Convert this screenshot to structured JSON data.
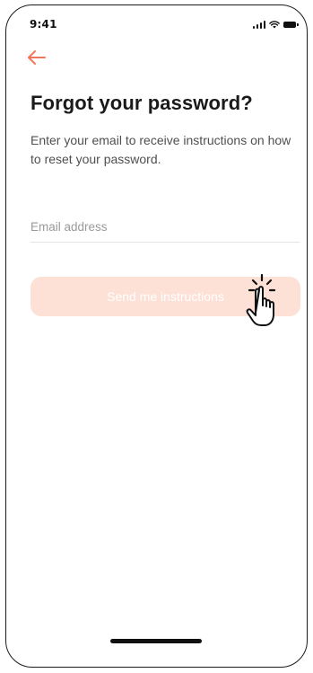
{
  "status_bar": {
    "time": "9:41",
    "icons": [
      "signal-icon",
      "wifi-icon",
      "battery-icon"
    ]
  },
  "nav": {
    "back_icon": "arrow-left-icon"
  },
  "header": {
    "title": "Forgot your password?",
    "subtitle": "Enter your email to receive instructions on how to reset your password."
  },
  "form": {
    "email_value": "",
    "email_placeholder": "Email address",
    "submit_label": "Send me instructions",
    "submit_state": "disabled"
  },
  "overlay": {
    "gesture_icon": "tap-hand-icon"
  },
  "colors": {
    "accent": "#f0775a",
    "button_disabled_bg": "#fde1d6",
    "button_text": "#ffffff",
    "title_text": "#1a1a1a",
    "body_text": "#4f4f4f",
    "placeholder_text": "#9a9a9a"
  }
}
